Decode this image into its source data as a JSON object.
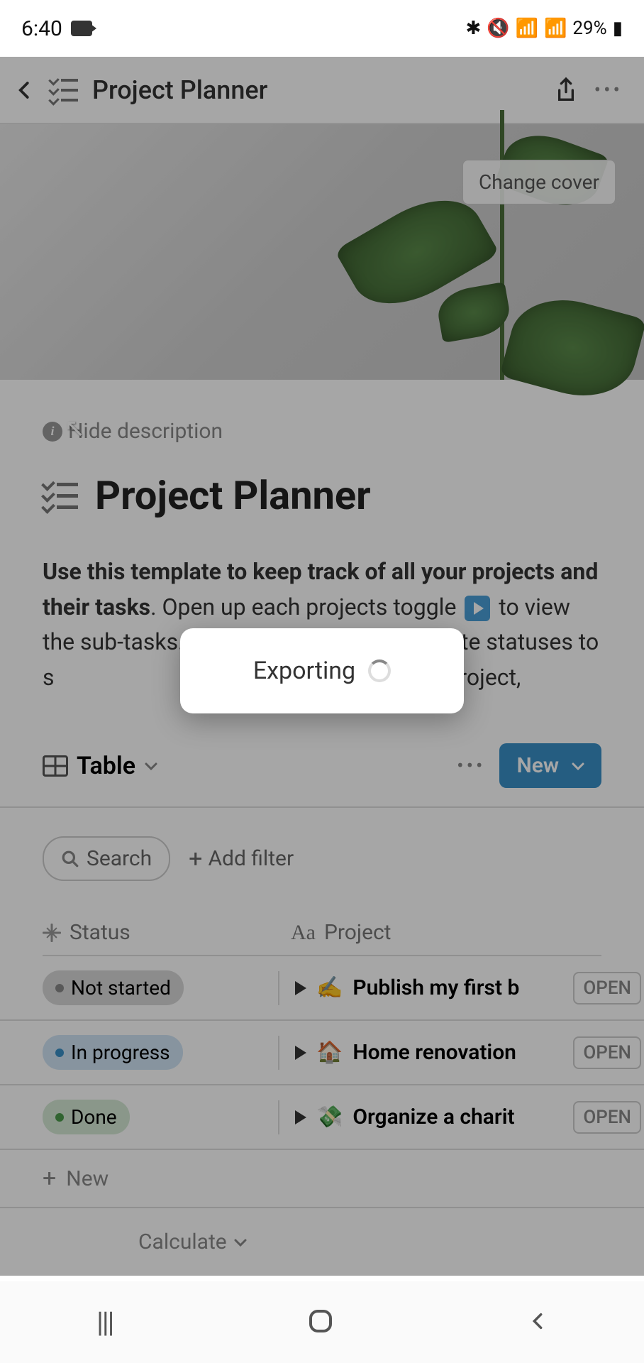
{
  "status_bar": {
    "time": "6:40",
    "battery_pct": "29%"
  },
  "header": {
    "title": "Project Planner"
  },
  "cover": {
    "change_label": "Change cover"
  },
  "hide_desc": "Hide description",
  "page_title": "Project Planner",
  "description_bold": "Use this template to keep track of all your projects and their tasks",
  "description_rest_1": ". Open up each projects toggle ",
  "description_rest_2": " to view the sub-tasks. Assign deadlines and update statuses to s",
  "description_rest_3": ". To add a new project, ",
  "view": {
    "label": "Table",
    "new_btn": "New"
  },
  "search": {
    "placeholder": "Search"
  },
  "add_filter": "Add filter",
  "columns": {
    "status": "Status",
    "project": "Project"
  },
  "rows": [
    {
      "status": "Not started",
      "status_bg": "#d8d8d8",
      "status_dot": "#888",
      "emoji": "✍️",
      "project": "Publish my first b",
      "open": "OPEN"
    },
    {
      "status": "In progress",
      "status_bg": "#d0e4f5",
      "status_dot": "#3a8fc7",
      "emoji": "🏠",
      "project": "Home renovation",
      "open": "OPEN"
    },
    {
      "status": "Done",
      "status_bg": "#d4e8d4",
      "status_dot": "#4a9a4a",
      "emoji": "💸",
      "project": "Organize a charit",
      "open": "OPEN"
    }
  ],
  "new_row_label": "New",
  "calculate_label": "Calculate",
  "modal": {
    "text": "Exporting"
  }
}
